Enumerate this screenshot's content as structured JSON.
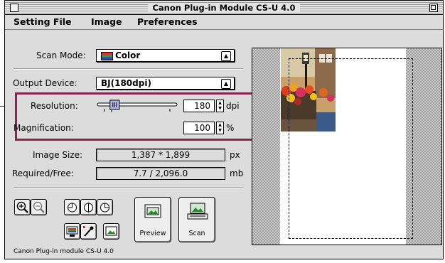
{
  "window": {
    "title": "Canon Plug-in Module CS-U 4.0"
  },
  "menu": [
    "Setting File",
    "Image",
    "Preferences"
  ],
  "scan_mode": {
    "label": "Scan Mode:",
    "value": "Color"
  },
  "output_device": {
    "label": "Output Device:",
    "value": "BJ(180dpi)"
  },
  "resolution": {
    "label": "Resolution:",
    "value": "180",
    "unit": "dpi",
    "slider_fraction": 0.18
  },
  "magnification": {
    "label": "Magnification:",
    "value": "100",
    "unit": "%"
  },
  "image_size": {
    "label": "Image Size:",
    "value": "1,387 * 1,899",
    "unit": "px"
  },
  "required_free": {
    "label": "Required/Free:",
    "value": "7.7 / 2,096.0",
    "unit": "mb"
  },
  "buttons": {
    "preview": "Preview",
    "scan": "Scan"
  },
  "icons": [
    "zoom-in-icon",
    "zoom-out-icon",
    "rotate-left-icon",
    "flip-icon",
    "rotate-right-icon",
    "color-settings-icon",
    "eyedropper-icon",
    "image-adjust-icon",
    "preview-icon",
    "scan-icon"
  ],
  "status": "Canon Plug-in module CS-U 4.0",
  "colors": {
    "highlight": "#8b2451",
    "chrome": "#dcdcdc"
  }
}
